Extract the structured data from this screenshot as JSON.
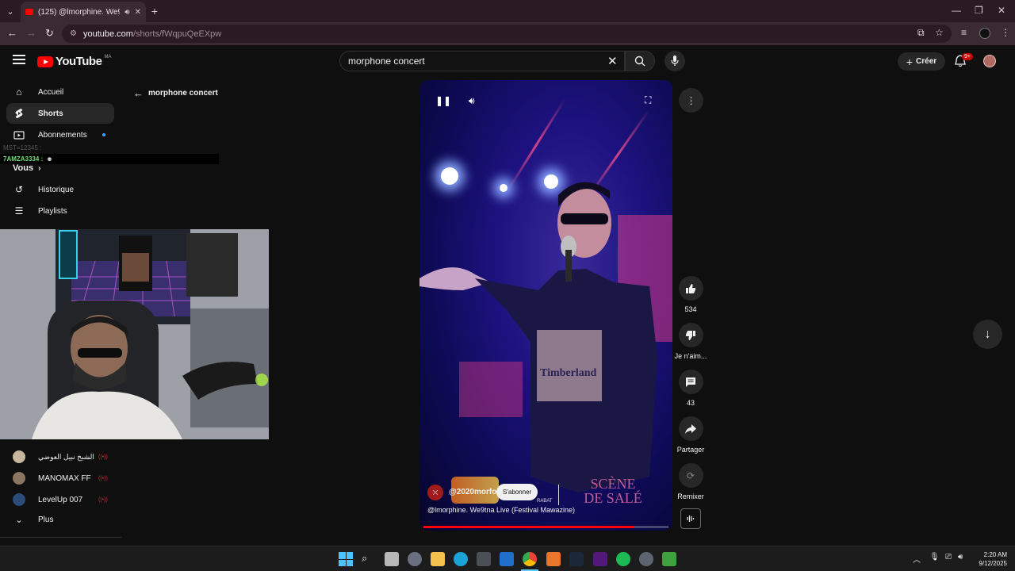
{
  "browser": {
    "tab_title": "(125) @lmorphine. We9tna",
    "url_domain": "youtube.com",
    "url_path": "/shorts/fWqpuQeEXpw"
  },
  "header": {
    "logo_text": "YouTube",
    "country_code": "MA",
    "search_value": "morphone concert",
    "create_label": "Créer",
    "notif_count": "9+"
  },
  "sidebar": {
    "items": [
      {
        "label": "Accueil",
        "icon": "home-icon"
      },
      {
        "label": "Shorts",
        "icon": "shorts-icon"
      },
      {
        "label": "Abonnements",
        "icon": "subscriptions-icon"
      }
    ],
    "you_label": "Vous",
    "you_items": [
      {
        "label": "Historique",
        "icon": "history-icon"
      },
      {
        "label": "Playlists",
        "icon": "playlist-icon"
      }
    ],
    "subscriptions": [
      {
        "label": "الشيخ نبيل العوضي",
        "color": "#c9b8a0"
      },
      {
        "label": "MANOMAX FF",
        "color": "#8c7660"
      },
      {
        "label": "LevelUp 007",
        "color": "#2c4a7a"
      }
    ],
    "more_label": "Plus"
  },
  "chat_overlay": {
    "user1": "MST=12345 :",
    "user2": "7AMZA3334 :"
  },
  "shorts": {
    "back_label": "morphone concert",
    "channel_handle": "@2020morfo",
    "subscribe_label": "S'abonner",
    "caption": "@lmorphine. We9tna Live (Festival Mawazine)",
    "overlay_brand": "SCÈNE DE SALÉ",
    "overlay_city": "RABAT",
    "shirt_text": "Timberland",
    "progress_fraction": 0.86
  },
  "actions": {
    "like_count": "534",
    "dislike_label": "Je n'aim...",
    "comments_count": "43",
    "share_label": "Partager",
    "remix_label": "Remixer"
  },
  "taskbar": {
    "time": "2:20 AM",
    "date": "9/12/2025"
  },
  "colors": {
    "accent_red": "#ff0000",
    "background": "#0f0f0f"
  }
}
